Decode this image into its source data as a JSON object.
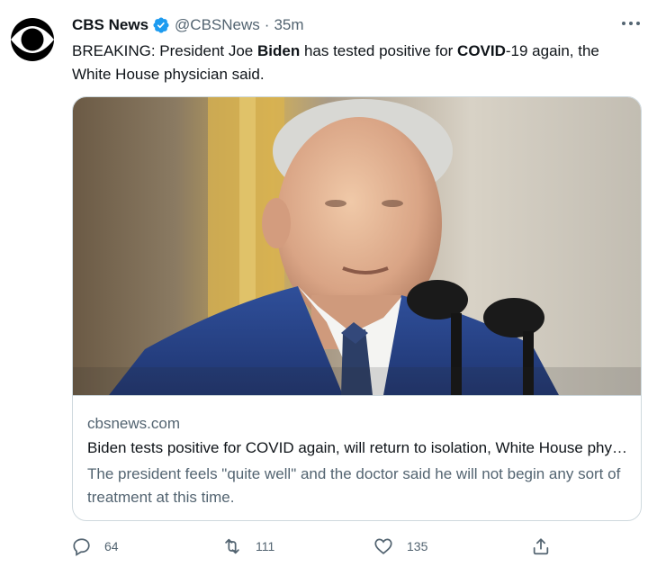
{
  "tweet": {
    "display_name": "CBS News",
    "handle": "@CBSNews",
    "separator": "·",
    "time": "35m",
    "more_label": "···",
    "text_parts": [
      {
        "text": "BREAKING: President Joe ",
        "bold": false
      },
      {
        "text": "Biden",
        "bold": true
      },
      {
        "text": " has tested positive for ",
        "bold": false
      },
      {
        "text": "COVID",
        "bold": true
      },
      {
        "text": "-19 again, the White House physician said.",
        "bold": false
      }
    ]
  },
  "card": {
    "domain": "cbsnews.com",
    "title": "Biden tests positive for COVID again, will return to isolation, White House physician says",
    "description": "The president feels \"quite well\" and the doctor said he will not begin any sort of treatment at this time."
  },
  "actions": {
    "reply": {
      "icon": "reply-icon",
      "count": "64"
    },
    "retweet": {
      "icon": "retweet-icon",
      "count": "111"
    },
    "like": {
      "icon": "heart-icon",
      "count": "135"
    },
    "share": {
      "icon": "share-icon"
    }
  },
  "colors": {
    "text_primary": "#0f1419",
    "text_secondary": "#536471",
    "verified_badge": "#1d9bf0",
    "border": "#cfd9de"
  }
}
